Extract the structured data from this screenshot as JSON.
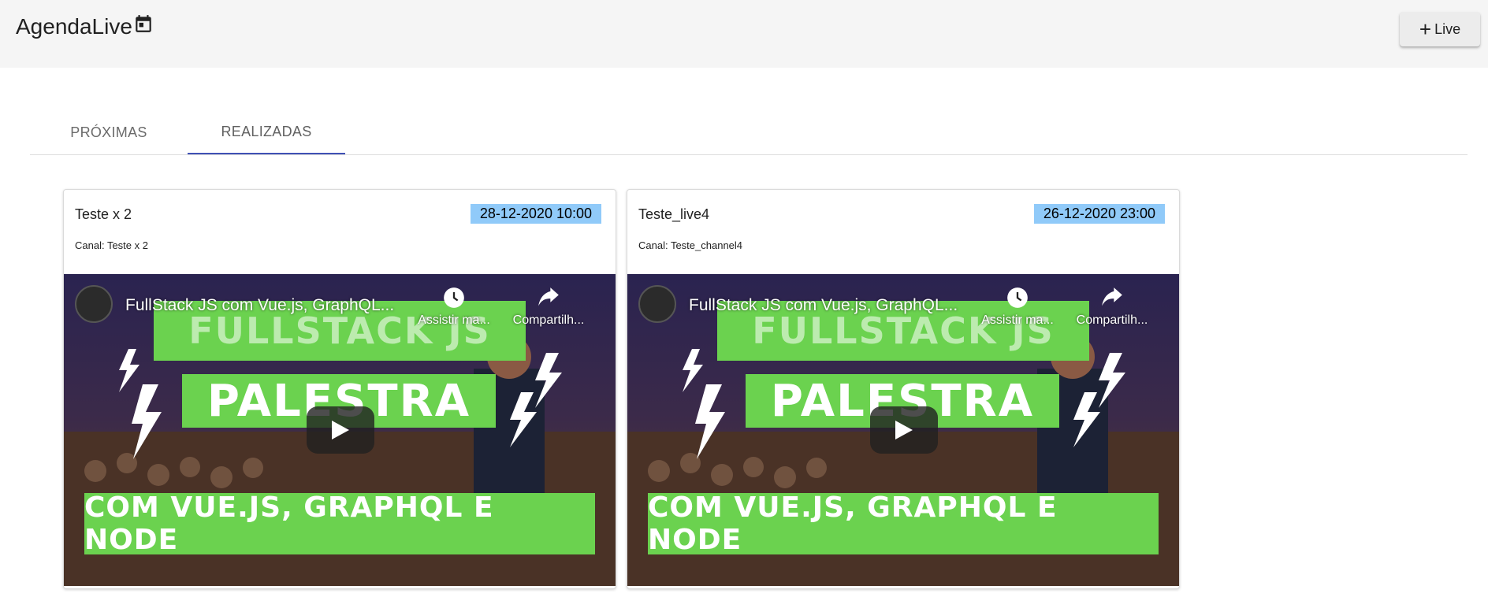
{
  "header": {
    "app_title": "AgendaLive",
    "calendar_icon": "calendar-icon",
    "live_button_label": "Live",
    "live_button_icon": "plus-icon"
  },
  "tabs": [
    {
      "label": "Próximas",
      "active": false
    },
    {
      "label": "Realizadas",
      "active": true
    }
  ],
  "colors": {
    "tab_indicator": "#3f51b5",
    "date_badge": "#90caf9",
    "thumbnail_band": "#6bd24f"
  },
  "cards": [
    {
      "title": "Teste x 2",
      "date": "28-12-2020 10:00",
      "channel": "Canal: Teste x 2",
      "video": {
        "title": "FullStack JS com Vue.js, GraphQL...",
        "watch_later": "Assistir ma...",
        "share": "Compartilh...",
        "band_top": "FULLSTACK JS",
        "band_mid": "PALESTRA",
        "band_bottom": "COM VUE.JS, GRAPHQL E NODE"
      }
    },
    {
      "title": "Teste_live4",
      "date": "26-12-2020 23:00",
      "channel": "Canal: Teste_channel4",
      "video": {
        "title": "FullStack JS com Vue.js, GraphQL...",
        "watch_later": "Assistir ma...",
        "share": "Compartilh...",
        "band_top": "FULLSTACK JS",
        "band_mid": "PALESTRA",
        "band_bottom": "COM VUE.JS, GRAPHQL E NODE"
      }
    }
  ]
}
